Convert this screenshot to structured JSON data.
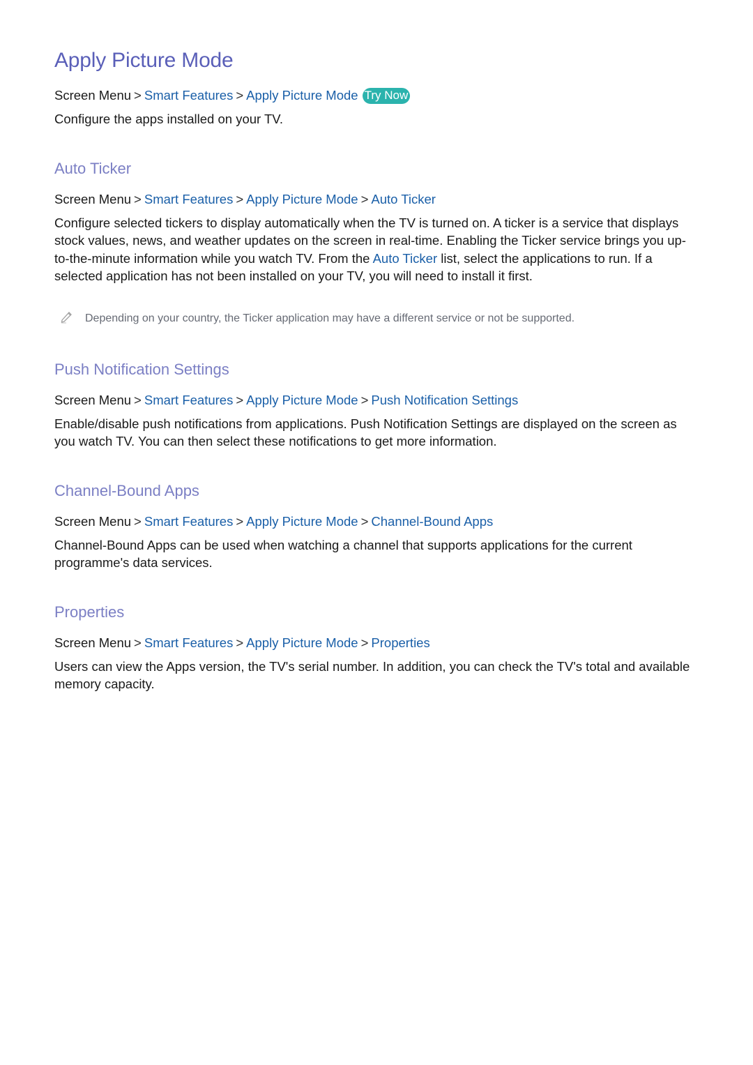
{
  "page": {
    "title": "Apply Picture Mode",
    "breadcrumb": {
      "root": "Screen Menu",
      "items": [
        "Smart Features",
        "Apply Picture Mode"
      ],
      "badge": "Try Now"
    },
    "intro": "Configure the apps installed on your TV."
  },
  "sections": [
    {
      "heading": "Auto Ticker",
      "breadcrumb": {
        "root": "Screen Menu",
        "items": [
          "Smart Features",
          "Apply Picture Mode",
          "Auto Ticker"
        ]
      },
      "body_part1": "Configure selected tickers to display automatically when the TV is turned on. A ticker is a service that displays stock values, news, and weather updates on the screen in real-time. Enabling the Ticker service brings you up-to-the-minute information while you watch TV. From the ",
      "body_link": "Auto Ticker",
      "body_part2": " list, select the applications to run. If a selected application has not been installed on your TV, you will need to install it first.",
      "note": "Depending on your country, the Ticker application may have a different service or not be supported."
    },
    {
      "heading": "Push Notification Settings",
      "breadcrumb": {
        "root": "Screen Menu",
        "items": [
          "Smart Features",
          "Apply Picture Mode",
          "Push Notification Settings"
        ]
      },
      "body": "Enable/disable push notifications from applications. Push Notification Settings are displayed on the screen as you watch TV. You can then select these notifications to get more information."
    },
    {
      "heading": "Channel-Bound Apps",
      "breadcrumb": {
        "root": "Screen Menu",
        "items": [
          "Smart Features",
          "Apply Picture Mode",
          "Channel-Bound Apps"
        ]
      },
      "body": "Channel-Bound Apps can be used when watching a channel that supports applications for the current programme's data services."
    },
    {
      "heading": "Properties",
      "breadcrumb": {
        "root": "Screen Menu",
        "items": [
          "Smart Features",
          "Apply Picture Mode",
          "Properties"
        ]
      },
      "body": "Users can view the Apps version, the TV's serial number. In addition, you can check the TV's total and available memory capacity."
    }
  ],
  "icons": {
    "separator": "chevron-right-icon",
    "note": "pencil-icon"
  },
  "colors": {
    "title": "#5a5fb8",
    "heading": "#7b7fc4",
    "link": "#1a5fa8",
    "badge": "#2bb3ad",
    "note": "#666a74"
  }
}
